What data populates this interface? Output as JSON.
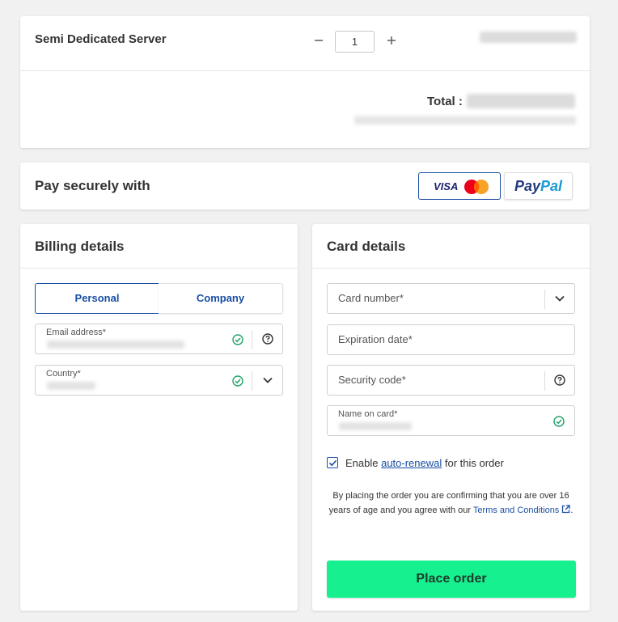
{
  "order": {
    "product_name": "Semi Dedicated Server",
    "quantity": "1",
    "minus_icon": "minus-icon",
    "plus_icon": "plus-icon",
    "total_label": "Total :"
  },
  "payment": {
    "title": "Pay securely with",
    "visa_label": "VISA",
    "paypal_part1": "Pay",
    "paypal_part2": "Pal"
  },
  "billing": {
    "title": "Billing details",
    "tabs": [
      "Personal",
      "Company"
    ],
    "email_label": "Email address*",
    "country_label": "Country*"
  },
  "card": {
    "title": "Card details",
    "card_number_placeholder": "Card number*",
    "expiration_placeholder": "Expiration date*",
    "security_placeholder": "Security code*",
    "name_label": "Name on card*",
    "renew_prefix": "Enable ",
    "renew_link": "auto-renewal",
    "renew_suffix": " for this order",
    "renew_checked": true,
    "terms_text": "By placing the order you are confirming that you are over 16 years of age and you agree with our ",
    "terms_link": "Terms and Conditions",
    "terms_end": ".",
    "place_order": "Place order"
  },
  "colors": {
    "accent": "#1a4ea3",
    "success": "#21a366",
    "button": "#17f08f",
    "background": "#f1f1f1"
  }
}
